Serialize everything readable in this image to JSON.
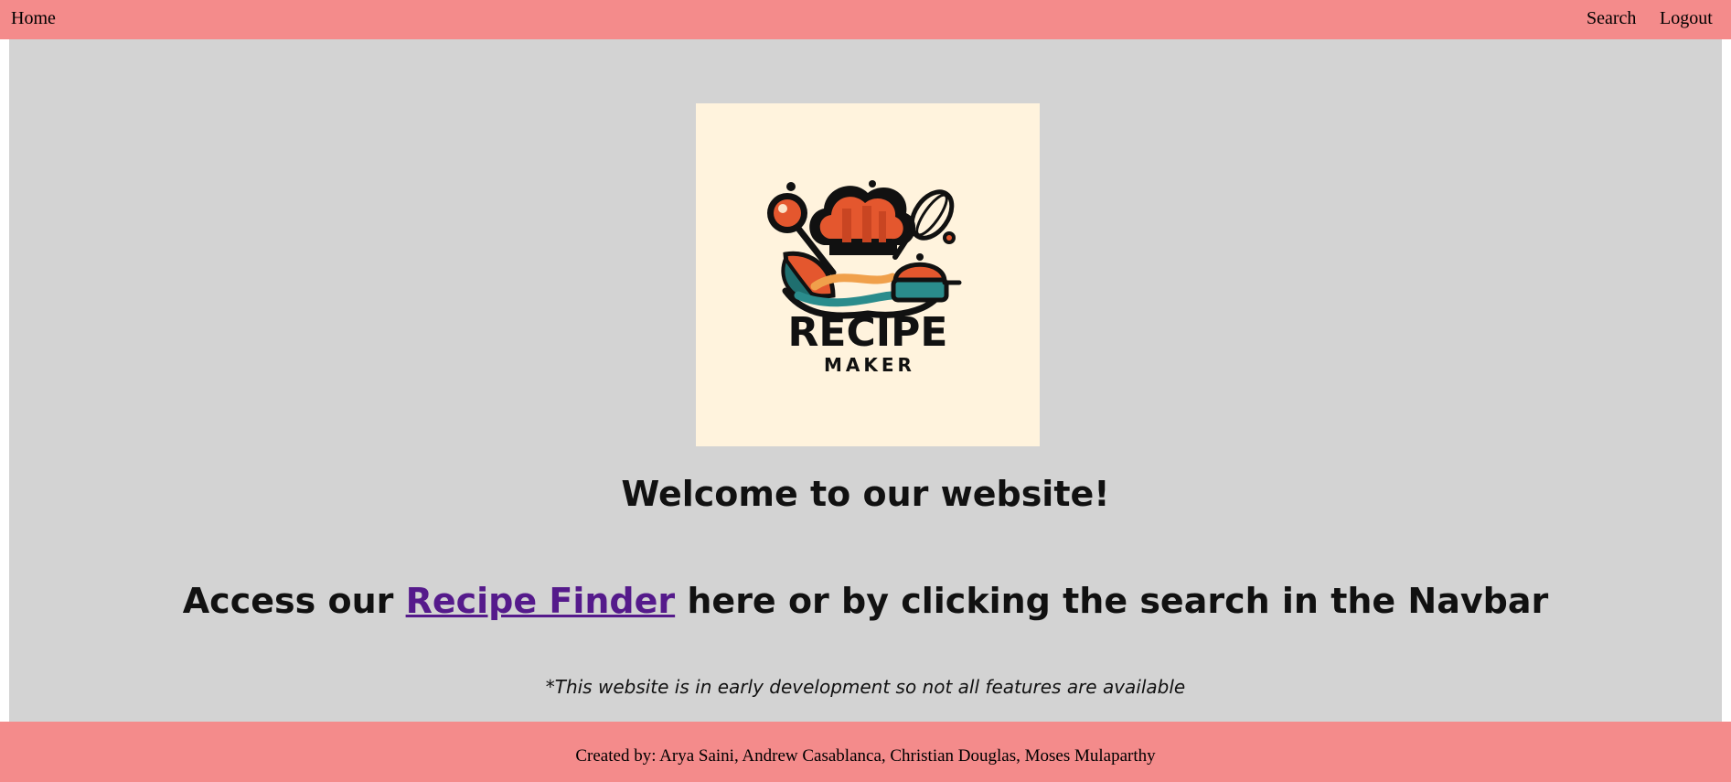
{
  "navbar": {
    "home_label": "Home",
    "search_label": "Search",
    "logout_label": "Logout",
    "color": "#f48b8b"
  },
  "logo": {
    "line1": "RECIPE",
    "line2": "MAKER",
    "background": "#fff3dd"
  },
  "main": {
    "background": "#d3d3d3",
    "welcome": "Welcome to our website!",
    "access_prefix": "Access our ",
    "recipe_finder_link": "Recipe Finder",
    "access_suffix": " here or by clicking the search in the Navbar",
    "note": "*This website is in early development so not all features are available"
  },
  "footer": {
    "text": "Created by: Arya Saini, Andrew Casablanca, Christian Douglas, Moses Mulaparthy"
  }
}
